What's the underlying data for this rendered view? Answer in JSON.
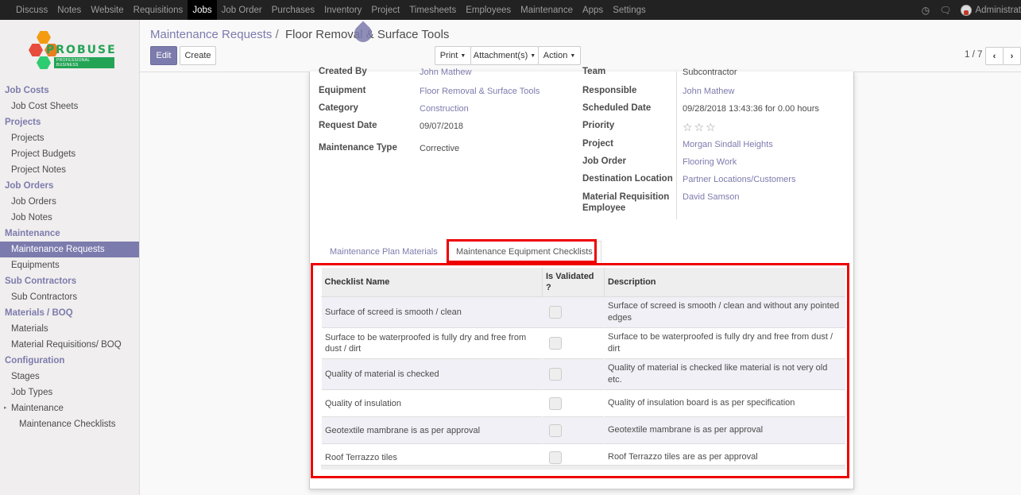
{
  "topbar": {
    "menu": [
      "Discuss",
      "Notes",
      "Website",
      "Requisitions",
      "Jobs",
      "Job Order",
      "Purchases",
      "Inventory",
      "Project",
      "Timesheets",
      "Employees",
      "Maintenance",
      "Apps",
      "Settings"
    ],
    "active_index": 4,
    "user_name": "Administrat",
    "icons": [
      "clock-icon",
      "chat-icon"
    ]
  },
  "logo": {
    "brand": "PROBUSE",
    "tagline": "PROFESSIONAL BUSINESS"
  },
  "sidebar": {
    "sections": [
      {
        "title": "Job Costs",
        "items": [
          {
            "label": "Job Cost Sheets"
          }
        ]
      },
      {
        "title": "Projects",
        "items": [
          {
            "label": "Projects"
          },
          {
            "label": "Project Budgets"
          },
          {
            "label": "Project Notes"
          }
        ]
      },
      {
        "title": "Job Orders",
        "items": [
          {
            "label": "Job Orders"
          },
          {
            "label": "Job Notes"
          }
        ]
      },
      {
        "title": "Maintenance",
        "items": [
          {
            "label": "Maintenance Requests",
            "active": true
          },
          {
            "label": "Equipments"
          }
        ]
      },
      {
        "title": "Sub Contractors",
        "items": [
          {
            "label": "Sub Contractors"
          }
        ]
      },
      {
        "title": "Materials / BOQ",
        "items": [
          {
            "label": "Materials"
          },
          {
            "label": "Material Requisitions/ BOQ"
          }
        ]
      },
      {
        "title": "Configuration",
        "items": [
          {
            "label": "Stages"
          },
          {
            "label": "Job Types"
          },
          {
            "label": "Maintenance",
            "expandable": true
          },
          {
            "label": "Maintenance Checklists",
            "sub": true
          }
        ]
      }
    ]
  },
  "breadcrumb": {
    "parent": "Maintenance Requests",
    "separator": "/",
    "current": "Floor Removal & Surface Tools"
  },
  "toolbar": {
    "edit_label": "Edit",
    "create_label": "Create",
    "print_label": "Print",
    "attachments_label": "Attachment(s)",
    "action_label": "Action"
  },
  "pager": {
    "value": "1 / 7"
  },
  "form": {
    "left": [
      {
        "label": "Created By",
        "value": "John Mathew",
        "link": true
      },
      {
        "label": "Equipment",
        "value": "Floor Removal & Surface Tools",
        "link": true
      },
      {
        "label": "Category",
        "value": "Construction",
        "link": true
      },
      {
        "label": "Request Date",
        "value": "09/07/2018",
        "link": false
      },
      {
        "label": "Maintenance Type",
        "value": "Corrective",
        "link": false
      }
    ],
    "right": [
      {
        "label": "Team",
        "value": "Subcontractor",
        "link": false
      },
      {
        "label": "Responsible",
        "value": "John Mathew",
        "link": true
      },
      {
        "label": "Scheduled Date",
        "value": "09/28/2018 13:43:36 for 0.00 hours",
        "link": false
      },
      {
        "label": "Priority",
        "value": "☆☆☆",
        "link": false
      },
      {
        "label": "Project",
        "value": "Morgan Sindall Heights",
        "link": true
      },
      {
        "label": "Job Order",
        "value": "Flooring Work",
        "link": true
      },
      {
        "label": "Destination Location",
        "value": "Partner Locations/Customers",
        "link": true
      },
      {
        "label": "Material Requisition Employee",
        "value": "David Samson",
        "link": true
      }
    ],
    "priority_stars": 0
  },
  "tabs": [
    {
      "label": "Maintenance Plan Materials",
      "active": false
    },
    {
      "label": "Maintenance Equipment Checklists",
      "active": true
    }
  ],
  "checklist_table": {
    "columns": [
      "Checklist Name",
      "Is Validated ?",
      "Description"
    ],
    "rows": [
      {
        "name": "Surface of screed is smooth / clean",
        "validated": false,
        "description": "Surface of screed is smooth / clean and without any pointed edges"
      },
      {
        "name": "Surface to be waterproofed is fully dry and free from dust / dirt",
        "validated": false,
        "description": "Surface to be waterproofed is fully dry and free from dust / dirt"
      },
      {
        "name": "Quality of material is checked",
        "validated": false,
        "description": "Quality of material is checked like material is not very old etc."
      },
      {
        "name": "Quality of insulation",
        "validated": false,
        "description": "Quality of insulation board is as per specification"
      },
      {
        "name": "Geotextile mambrane is as per approval",
        "validated": false,
        "description": "Geotextile mambrane is as per approval"
      },
      {
        "name": "Roof Terrazzo tiles",
        "validated": false,
        "description": "Roof Terrazzo tiles are as per approval"
      }
    ]
  },
  "colors": {
    "accent": "#7c7bad",
    "highlight": "#e00000",
    "topbar": "#222222"
  }
}
